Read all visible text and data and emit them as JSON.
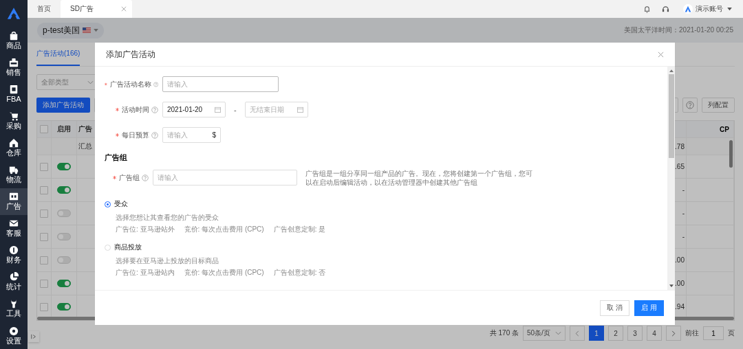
{
  "sidebar": {
    "items": [
      {
        "label": "商品",
        "selected": false
      },
      {
        "label": "销售",
        "selected": false
      },
      {
        "label": "FBA",
        "selected": false
      },
      {
        "label": "采购",
        "selected": false
      },
      {
        "label": "仓库",
        "selected": false
      },
      {
        "label": "物流",
        "selected": false
      },
      {
        "label": "广告",
        "selected": true
      },
      {
        "label": "客服",
        "selected": false
      },
      {
        "label": "财务",
        "selected": false
      },
      {
        "label": "统计",
        "selected": false
      },
      {
        "label": "工具",
        "selected": false
      },
      {
        "label": "设置",
        "selected": false
      }
    ]
  },
  "top_tabs": [
    {
      "label": "首页",
      "selected": false,
      "closable": false
    },
    {
      "label": "SD广告",
      "selected": true,
      "closable": true
    }
  ],
  "header": {
    "account": "演示账号"
  },
  "store": {
    "name": "p-test美国"
  },
  "timezone": "美国太平洋时间：2021-01-20 00:25",
  "page_tabs": [
    {
      "label": "广告活动(166)",
      "selected": true
    }
  ],
  "filter": {
    "value": "全部类型"
  },
  "add_button": "添加广告活动",
  "column_config_button": "列配置",
  "table": {
    "columns": [
      "启用",
      "广告",
      "CP"
    ],
    "header_checked": false,
    "summary": {
      "label": "汇总",
      "value": ".78"
    },
    "rows": [
      {
        "checked": false,
        "enabled": true,
        "value": ".65"
      },
      {
        "checked": false,
        "enabled": true,
        "value": "-"
      },
      {
        "checked": false,
        "enabled": false,
        "value": "-"
      },
      {
        "checked": false,
        "enabled": false,
        "value": "-"
      },
      {
        "checked": false,
        "enabled": false,
        "value": ".00"
      },
      {
        "checked": false,
        "enabled": true,
        "value": ".00"
      },
      {
        "checked": false,
        "enabled": true,
        "value": ".94"
      }
    ]
  },
  "pagination": {
    "total": "共 170 条",
    "page_size": "50条/页",
    "pages": [
      {
        "label": "1",
        "selected": true
      },
      {
        "label": "2",
        "selected": false
      },
      {
        "label": "3",
        "selected": false
      },
      {
        "label": "4",
        "selected": false
      }
    ],
    "goto_label": "前往",
    "goto_value": "1",
    "page_unit": "页"
  },
  "modal": {
    "title": "添加广告活动",
    "fields": [
      {
        "kind": "text",
        "label": "广告活动名称",
        "required": true,
        "placeholder": "请输入"
      },
      {
        "kind": "daterange",
        "label": "活动时间",
        "required": true,
        "value": "2021-01-20",
        "separator": "-",
        "end_placeholder": "无结束日期"
      },
      {
        "kind": "money",
        "label": "每日预算",
        "required": true,
        "placeholder": "请输入",
        "unit": "$"
      }
    ],
    "section_title": "广告组",
    "group_field": {
      "label": "广告组",
      "required": true,
      "placeholder": "请输入",
      "help": "广告组是一组分享同一组产品的广告。现在，您将创建第一个广告组，您可以在启动后编辑活动，以在活动管理器中创建其他广告组"
    },
    "targeting": [
      {
        "label": "受众",
        "selected": true,
        "description": "选择您想让其查看您的广告的受众",
        "meta": [
          "广告位: 亚马逊站外",
          "竞价: 每次点击费用 (CPC)",
          "广告创意定制: 是"
        ]
      },
      {
        "label": "商品投放",
        "selected": false,
        "description": "选择要在亚马逊上投放的目标商品",
        "meta": [
          "广告位: 亚马逊站内",
          "竞价: 每次点击费用 (CPC)",
          "广告创意定制: 否"
        ]
      }
    ],
    "cancel_button": "取 消",
    "ok_button": "启 用"
  }
}
